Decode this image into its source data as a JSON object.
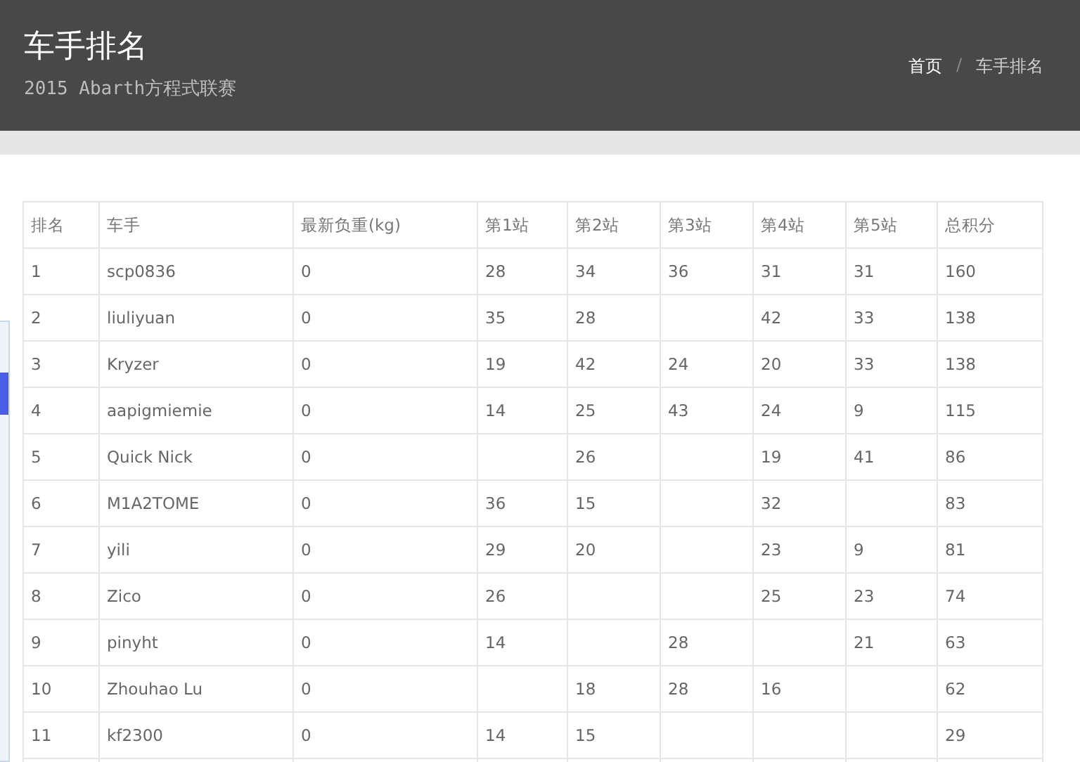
{
  "header": {
    "title": "车手排名",
    "subtitle": "2015 Abarth方程式联赛",
    "breadcrumb_separator": "/",
    "breadcrumb": [
      {
        "label": "首页",
        "selected": false
      },
      {
        "label": "车手排名",
        "selected": true
      }
    ]
  },
  "table": {
    "columns": [
      "排名",
      "车手",
      "最新负重(kg)",
      "第1站",
      "第2站",
      "第3站",
      "第4站",
      "第5站",
      "总积分"
    ],
    "rows": [
      [
        "1",
        "scp0836",
        "0",
        "28",
        "34",
        "36",
        "31",
        "31",
        "160"
      ],
      [
        "2",
        "liuliyuan",
        "0",
        "35",
        "28",
        null,
        "42",
        "33",
        "138"
      ],
      [
        "3",
        "Kryzer",
        "0",
        "19",
        "42",
        "24",
        "20",
        "33",
        "138"
      ],
      [
        "4",
        "aapigmiemie",
        "0",
        "14",
        "25",
        "43",
        "24",
        "9",
        "115"
      ],
      [
        "5",
        "Quick Nick",
        "0",
        null,
        "26",
        null,
        "19",
        "41",
        "86"
      ],
      [
        "6",
        "M1A2TOME",
        "0",
        "36",
        "15",
        null,
        "32",
        null,
        "83"
      ],
      [
        "7",
        "yili",
        "0",
        "29",
        "20",
        null,
        "23",
        "9",
        "81"
      ],
      [
        "8",
        "Zico",
        "0",
        "26",
        null,
        null,
        "25",
        "23",
        "74"
      ],
      [
        "9",
        "pinyht",
        "0",
        "14",
        null,
        "28",
        null,
        "21",
        "63"
      ],
      [
        "10",
        "Zhouhao Lu",
        "0",
        null,
        "18",
        "28",
        "16",
        null,
        "62"
      ],
      [
        "11",
        "kf2300",
        "0",
        "14",
        "15",
        null,
        null,
        null,
        "29"
      ]
    ]
  }
}
